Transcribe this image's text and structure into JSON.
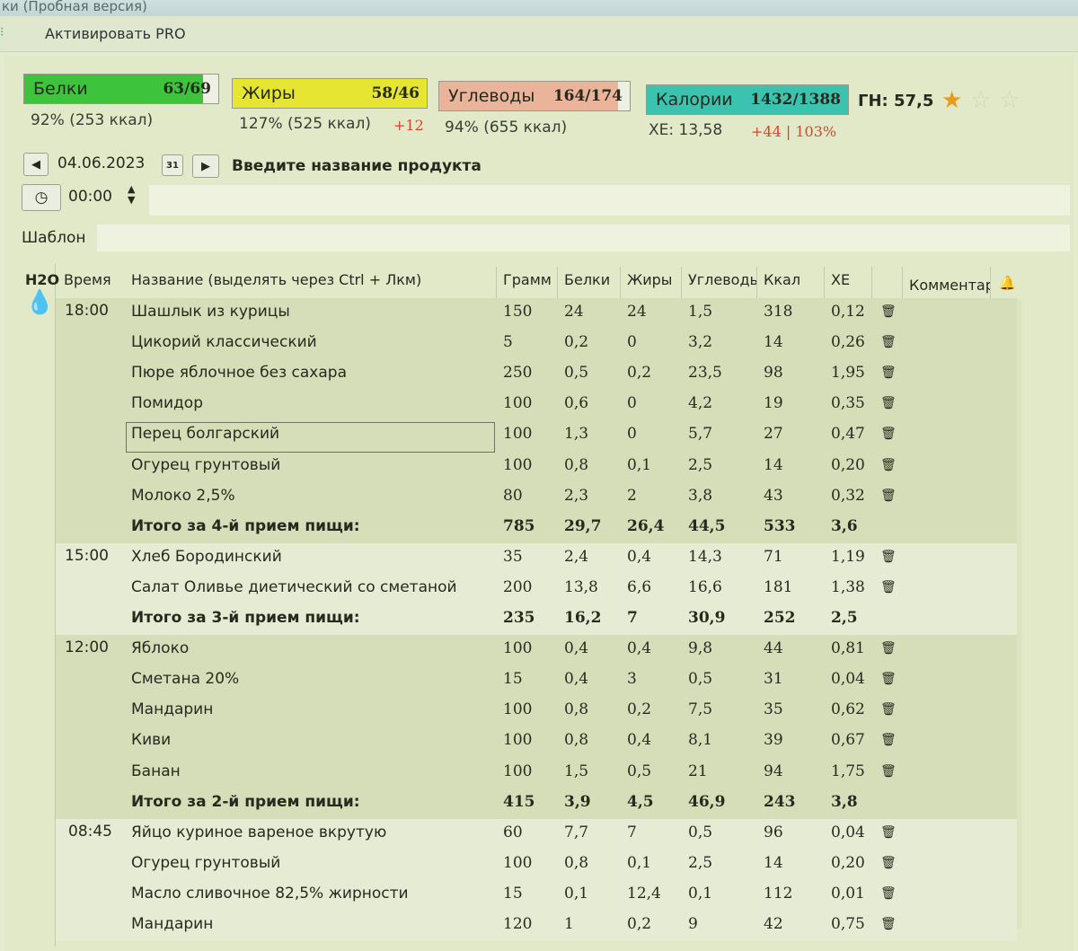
{
  "window": {
    "title": "ки (Пробная версия)",
    "menu_activate": "Активировать PRO"
  },
  "summary": {
    "protein": {
      "label": "Белки",
      "value": "63/69",
      "sub": "92% (253 ккал)",
      "fill_fraction": 0.92,
      "color": "#3ec43c"
    },
    "fat": {
      "label": "Жиры",
      "value": "58/46",
      "sub": "127% (525 ккал)",
      "delta": "+12",
      "fill_fraction": 1.0,
      "color": "#e6e632"
    },
    "carbs": {
      "label": "Углеводы",
      "value": "164/174",
      "sub": "94% (655 ккал)",
      "fill_fraction": 0.94,
      "color": "#e9b49a"
    },
    "calories": {
      "label": "Калории",
      "value": "1432/1388",
      "sub": "ХЕ: 13,58",
      "delta": "+44 | 103%",
      "fill_fraction": 1.0,
      "color": "#3cc3b0"
    },
    "gn": "ГН: 57,5",
    "rating_stars": 1
  },
  "controls": {
    "date": "04.06.2023",
    "calendar_day": "31",
    "product_prompt": "Введите название продукта",
    "time": "00:00",
    "template_label": "Шаблон"
  },
  "table": {
    "headers": {
      "h2o": "H2O",
      "time": "Время",
      "name": "Название (выделять через Ctrl + Лкм)",
      "gram": "Грамм",
      "protein": "Белки",
      "fat": "Жиры",
      "carbs": "Углеводы",
      "kcal": "Ккал",
      "xe": "ХЕ",
      "comment": "Комментарий"
    },
    "meals": [
      {
        "time": "18:00",
        "items": [
          {
            "name": "Шашлык из курицы",
            "gram": "150",
            "protein": "24",
            "fat": "24",
            "carbs": "1,5",
            "kcal": "318",
            "xe": "0,12"
          },
          {
            "name": "Цикорий классический",
            "gram": "5",
            "protein": "0,2",
            "fat": "0",
            "carbs": "3,2",
            "kcal": "14",
            "xe": "0,26"
          },
          {
            "name": "Пюре яблочное без сахара",
            "gram": "250",
            "protein": "0,5",
            "fat": "0,2",
            "carbs": "23,5",
            "kcal": "98",
            "xe": "1,95"
          },
          {
            "name": "Помидор",
            "gram": "100",
            "protein": "0,6",
            "fat": "0",
            "carbs": "4,2",
            "kcal": "19",
            "xe": "0,35"
          },
          {
            "name": "Перец болгарский",
            "gram": "100",
            "protein": "1,3",
            "fat": "0",
            "carbs": "5,7",
            "kcal": "27",
            "xe": "0,47"
          },
          {
            "name": "Огурец грунтовый",
            "gram": "100",
            "protein": "0,8",
            "fat": "0,1",
            "carbs": "2,5",
            "kcal": "14",
            "xe": "0,20"
          },
          {
            "name": "Молоко 2,5%",
            "gram": "80",
            "protein": "2,3",
            "fat": "2",
            "carbs": "3,8",
            "kcal": "43",
            "xe": "0,32"
          }
        ],
        "total": {
          "name": "Итого за 4-й прием пищи:",
          "gram": "785",
          "protein": "29,7",
          "fat": "26,4",
          "carbs": "44,5",
          "kcal": "533",
          "xe": "3,6"
        }
      },
      {
        "time": "15:00",
        "items": [
          {
            "name": "Хлеб Бородинский",
            "gram": "35",
            "protein": "2,4",
            "fat": "0,4",
            "carbs": "14,3",
            "kcal": "71",
            "xe": "1,19"
          },
          {
            "name": "Салат Оливье диетический со сметаной",
            "gram": "200",
            "protein": "13,8",
            "fat": "6,6",
            "carbs": "16,6",
            "kcal": "181",
            "xe": "1,38"
          }
        ],
        "total": {
          "name": "Итого за 3-й прием пищи:",
          "gram": "235",
          "protein": "16,2",
          "fat": "7",
          "carbs": "30,9",
          "kcal": "252",
          "xe": "2,5"
        }
      },
      {
        "time": "12:00",
        "items": [
          {
            "name": "Яблоко",
            "gram": "100",
            "protein": "0,4",
            "fat": "0,4",
            "carbs": "9,8",
            "kcal": "44",
            "xe": "0,81"
          },
          {
            "name": "Сметана 20%",
            "gram": "15",
            "protein": "0,4",
            "fat": "3",
            "carbs": "0,5",
            "kcal": "31",
            "xe": "0,04"
          },
          {
            "name": "Мандарин",
            "gram": "100",
            "protein": "0,8",
            "fat": "0,2",
            "carbs": "7,5",
            "kcal": "35",
            "xe": "0,62"
          },
          {
            "name": "Киви",
            "gram": "100",
            "protein": "0,8",
            "fat": "0,4",
            "carbs": "8,1",
            "kcal": "39",
            "xe": "0,67"
          },
          {
            "name": "Банан",
            "gram": "100",
            "protein": "1,5",
            "fat": "0,5",
            "carbs": "21",
            "kcal": "94",
            "xe": "1,75"
          }
        ],
        "total": {
          "name": "Итого за 2-й прием пищи:",
          "gram": "415",
          "protein": "3,9",
          "fat": "4,5",
          "carbs": "46,9",
          "kcal": "243",
          "xe": "3,8"
        }
      },
      {
        "time": "08:45",
        "items": [
          {
            "name": "Яйцо куриное вареное вкрутую",
            "gram": "60",
            "protein": "7,7",
            "fat": "7",
            "carbs": "0,5",
            "kcal": "96",
            "xe": "0,04"
          },
          {
            "name": "Огурец грунтовый",
            "gram": "100",
            "protein": "0,8",
            "fat": "0,1",
            "carbs": "2,5",
            "kcal": "14",
            "xe": "0,20"
          },
          {
            "name": "Масло сливочное 82,5% жирности",
            "gram": "15",
            "protein": "0,1",
            "fat": "12,4",
            "carbs": "0,1",
            "kcal": "112",
            "xe": "0,01"
          },
          {
            "name": "Мандарин",
            "gram": "120",
            "protein": "1",
            "fat": "0,2",
            "carbs": "9",
            "kcal": "42",
            "xe": "0,75"
          }
        ]
      }
    ]
  },
  "icons": {
    "trash": "trash-icon",
    "water": "water-drop-icon",
    "bell": "bell-icon",
    "clock": "clock-icon",
    "calendar": "calendar-icon",
    "star": "star-icon"
  }
}
